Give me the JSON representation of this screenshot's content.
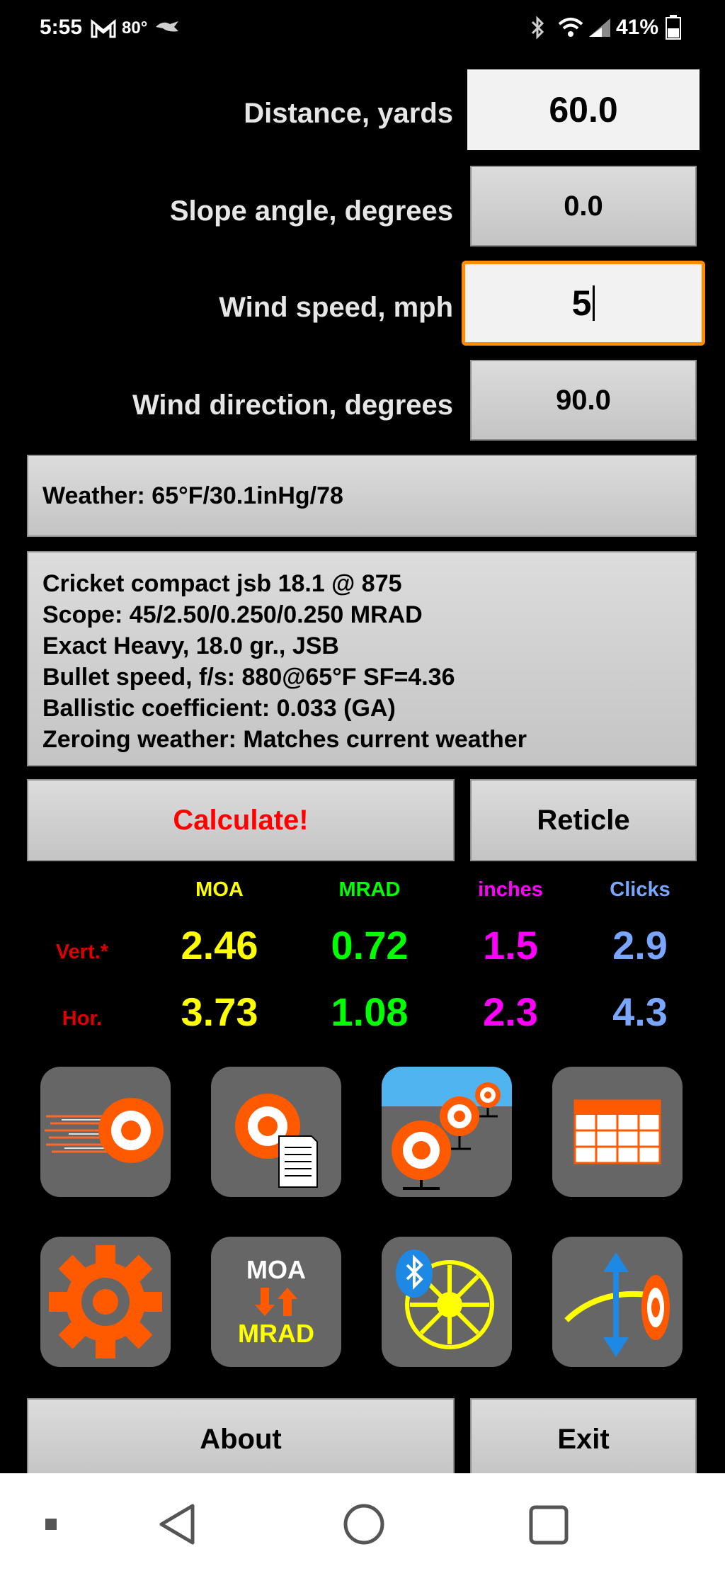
{
  "status_bar": {
    "time": "5:55",
    "temperature": "80°",
    "battery": "41%"
  },
  "inputs": {
    "distance": {
      "label": "Distance, yards",
      "value": "60.0"
    },
    "slope": {
      "label": "Slope angle, degrees",
      "value": "0.0"
    },
    "wind_speed": {
      "label": "Wind speed, mph",
      "value": "5"
    },
    "wind_direction": {
      "label": "Wind direction, degrees",
      "value": "90.0"
    }
  },
  "weather_button": {
    "label": "Weather: 65°F/30.1inHg/78"
  },
  "profile": {
    "lines": [
      "Cricket compact jsb 18.1 @ 875",
      "Scope: 45/2.50/0.250/0.250 MRAD",
      "Exact Heavy, 18.0 gr., JSB",
      "Bullet speed, f/s: 880@65°F SF=4.36",
      "Ballistic coefficient: 0.033 (GA)",
      "Zeroing weather: Matches current weather"
    ]
  },
  "actions": {
    "calculate": "Calculate!",
    "reticle": "Reticle",
    "about": "About",
    "exit": "Exit"
  },
  "results": {
    "headers": [
      "MOA",
      "MRAD",
      "inches",
      "Clicks"
    ],
    "header_colors": [
      "#ffff00",
      "#00ff00",
      "#ff00ff",
      "#79a6ff"
    ],
    "rows": [
      {
        "label": "Vert.*",
        "values": [
          "2.46",
          "0.72",
          "1.5",
          "2.9"
        ]
      },
      {
        "label": "Hor.",
        "values": [
          "3.73",
          "1.08",
          "2.3",
          "4.3"
        ]
      }
    ]
  },
  "tiles": {
    "moa_text": "MOA",
    "mrad_text": "MRAD"
  },
  "colors": {
    "accent_orange": "#ff5a00",
    "focus_border": "#ff8c00",
    "calculate_red": "#ff0000"
  }
}
